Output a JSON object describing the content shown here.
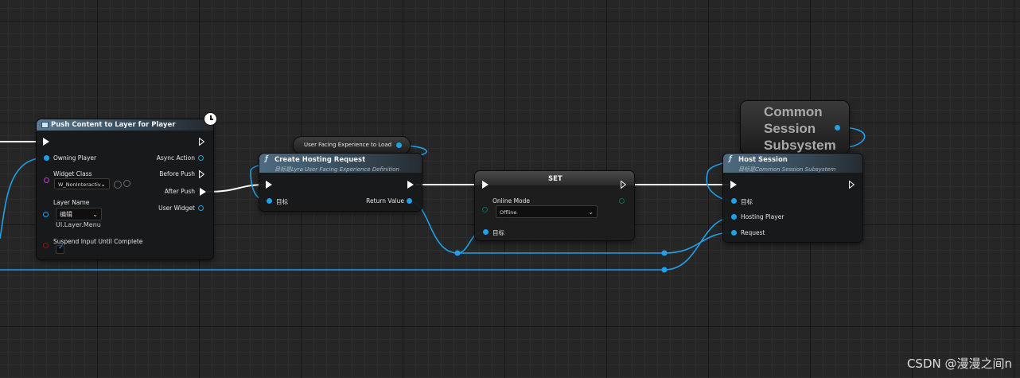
{
  "graph": {
    "push_node": {
      "title": "Push Content to Layer for Player",
      "pins_left": {
        "owning_player": "Owning Player",
        "widget_class": "Widget Class",
        "widget_class_value": "W_NonInteractiv",
        "layer_name": "Layer Name",
        "layer_name_value": "编辑",
        "layer_name_tag": "UI.Layer.Menu",
        "suspend_input": "Suspend Input Until Complete",
        "suspend_input_checked": true
      },
      "pins_right": {
        "async_action": "Async Action",
        "before_push": "Before Push",
        "after_push": "After Push",
        "user_widget": "User Widget"
      }
    },
    "experience_var": {
      "label": "User Facing Experience to Load"
    },
    "create_request": {
      "title": "Create Hosting Request",
      "subtitle": "目标是Lyra User Facing Experience Definition",
      "target_label": "目标",
      "return_label": "Return Value"
    },
    "set_node": {
      "title": "SET",
      "online_mode_label": "Online Mode",
      "online_mode_value": "Offline",
      "target_label": "目标"
    },
    "session_var": {
      "label": "Common Session Subsystem",
      "lines": [
        "Common",
        "Session",
        "Subsystem"
      ]
    },
    "host_session": {
      "title": "Host Session",
      "subtitle": "目标是Common Session Subsystem",
      "target_label": "目标",
      "hosting_player_label": "Hosting Player",
      "request_label": "Request"
    }
  },
  "watermark": "CSDN @漫漫之间n",
  "colors": {
    "exec": "#ffffff",
    "object_pin": "#1fa0e8",
    "class_pin": "#c040d0",
    "bool_pin": "#8e1010"
  }
}
